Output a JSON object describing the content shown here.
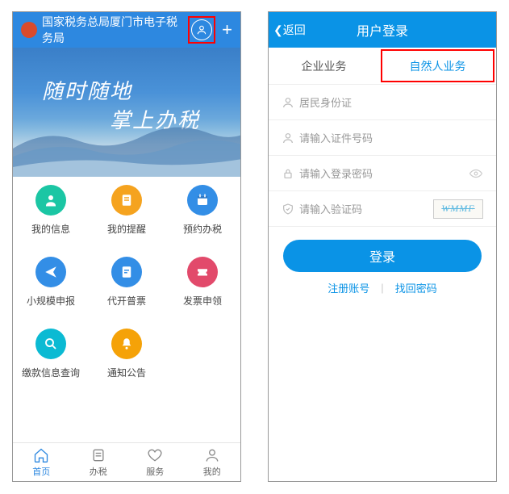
{
  "left": {
    "header": {
      "title": "国家税务总局厦门市电子税务局"
    },
    "banner": {
      "line1": "随时随地",
      "line2": "掌上办税"
    },
    "grid": [
      {
        "label": "我的信息",
        "icon": "person",
        "color": "c-green"
      },
      {
        "label": "我的提醒",
        "icon": "note",
        "color": "c-orange"
      },
      {
        "label": "预约办税",
        "icon": "calendar",
        "color": "c-blue"
      },
      {
        "label": "小规模申报",
        "icon": "send",
        "color": "c-blue"
      },
      {
        "label": "代开普票",
        "icon": "doc",
        "color": "c-blue"
      },
      {
        "label": "发票申领",
        "icon": "ticket",
        "color": "c-pink"
      },
      {
        "label": "缴款信息查询",
        "icon": "search",
        "color": "c-cyan"
      },
      {
        "label": "通知公告",
        "icon": "bell",
        "color": "c-yellow"
      }
    ],
    "nav": [
      {
        "label": "首页",
        "icon": "⌂",
        "active": true
      },
      {
        "label": "办税",
        "icon": "▤",
        "active": false
      },
      {
        "label": "服务",
        "icon": "♡",
        "active": false
      },
      {
        "label": "我的",
        "icon": "☺",
        "active": false
      }
    ]
  },
  "right": {
    "header": {
      "back": "返回",
      "title": "用户登录"
    },
    "tabs": {
      "tab1": "企业业务",
      "tab2": "自然人业务"
    },
    "form": {
      "idtype": "居民身份证",
      "idnum_placeholder": "请输入证件号码",
      "password_placeholder": "请输入登录密码",
      "captcha_placeholder": "请输入验证码",
      "captcha_img": "WMMF"
    },
    "login_btn": "登录",
    "links": {
      "register": "注册账号",
      "find": "找回密码"
    }
  }
}
